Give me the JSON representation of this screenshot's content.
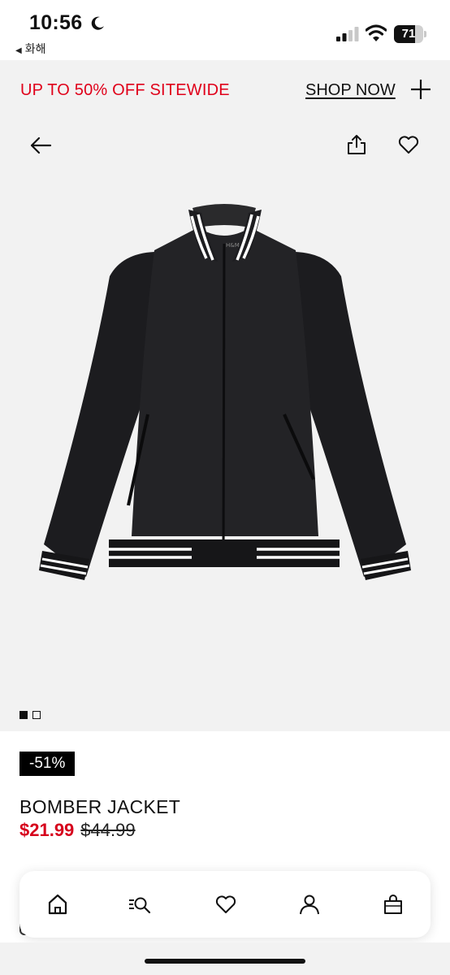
{
  "status_bar": {
    "time": "10:56",
    "back_app_label": "화해",
    "battery_level": "71",
    "battery_fraction": 0.71
  },
  "promo": {
    "text": "UP TO 50% OFF SITEWIDE",
    "link_label": "SHOP NOW"
  },
  "product": {
    "discount_badge": "-51%",
    "name": "BOMBER JACKET",
    "sale_price": "$21.99",
    "original_price": "$44.99",
    "image_count": 2,
    "active_image": 0
  },
  "icons": {
    "top": [
      "arrow-left-icon",
      "share-icon",
      "heart-icon"
    ],
    "bottom_nav": [
      "home-icon",
      "search-icon",
      "heart-icon",
      "user-icon",
      "shopping-bag-icon"
    ]
  },
  "colors": {
    "sale_red": "#d6001c",
    "promo_red": "#e0001a",
    "image_bg": "#f2f2f2",
    "badge_bg": "#000000"
  }
}
